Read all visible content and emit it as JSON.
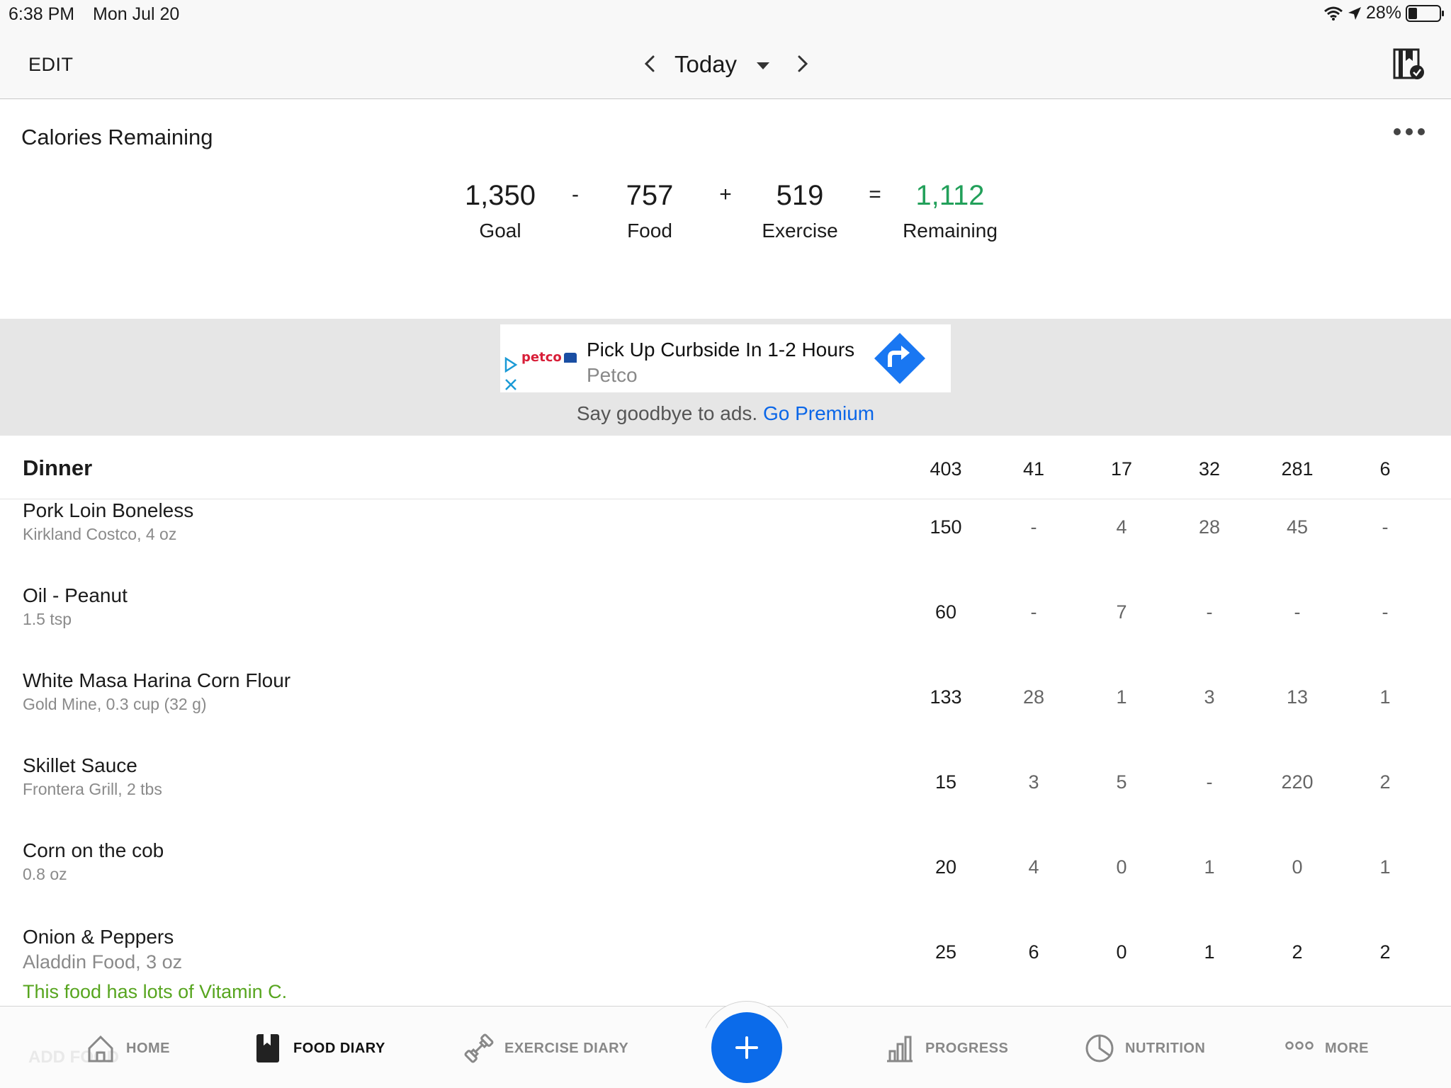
{
  "status": {
    "time": "6:38 PM",
    "date": "Mon Jul 20",
    "battery": "28%",
    "battery_level": 0.28
  },
  "nav": {
    "edit_label": "EDIT",
    "date_label": "Today"
  },
  "calories": {
    "title": "Calories Remaining",
    "goal": "1,350",
    "goal_label": "Goal",
    "op1": "-",
    "food": "757",
    "food_label": "Food",
    "op2": "+",
    "exercise": "519",
    "exercise_label": "Exercise",
    "op3": "=",
    "remaining": "1,112",
    "remaining_label": "Remaining",
    "remaining_color": "#22a05a"
  },
  "ad": {
    "brand": "petco",
    "headline": "Pick Up Curbside In 1-2 Hours",
    "sponsor": "Petco",
    "premium_text": "Say goodbye to ads.",
    "premium_link": "Go Premium"
  },
  "meal": {
    "name": "Dinner",
    "totals": [
      "403",
      "41",
      "17",
      "32",
      "281",
      "6"
    ],
    "items": [
      {
        "name": "Pork Loin Boneless",
        "desc": "Kirkland Costco, 4 oz",
        "values": [
          "150",
          "-",
          "4",
          "28",
          "45",
          "-"
        ]
      },
      {
        "name": "Oil - Peanut",
        "desc": "1.5 tsp",
        "values": [
          "60",
          "-",
          "7",
          "-",
          "-",
          "-"
        ]
      },
      {
        "name": "White Masa Harina Corn Flour",
        "desc": "Gold Mine, 0.3 cup (32 g)",
        "values": [
          "133",
          "28",
          "1",
          "3",
          "13",
          "1"
        ]
      },
      {
        "name": "Skillet Sauce",
        "desc": "Frontera Grill, 2 tbs",
        "values": [
          "15",
          "3",
          "5",
          "-",
          "220",
          "2"
        ]
      },
      {
        "name": "Corn on the cob",
        "desc": "0.8 oz",
        "values": [
          "20",
          "4",
          "0",
          "1",
          "0",
          "1"
        ]
      },
      {
        "name": "Onion & Peppers",
        "desc": "Aladdin Food, 3 oz",
        "values": [
          "25",
          "6",
          "0",
          "1",
          "2",
          "2"
        ],
        "note": "This food has lots of Vitamin C."
      }
    ],
    "add_food_label": "ADD FOOD"
  },
  "tabs": [
    {
      "label": "HOME",
      "icon": "home-icon"
    },
    {
      "label": "FOOD DIARY",
      "icon": "food-diary-icon"
    },
    {
      "label": "EXERCISE DIARY",
      "icon": "dumbbell-icon"
    },
    {
      "label": "PROGRESS",
      "icon": "bar-chart-icon"
    },
    {
      "label": "NUTRITION",
      "icon": "pie-chart-icon"
    },
    {
      "label": "MORE",
      "icon": "more-dots-icon"
    }
  ],
  "colors": {
    "accent": "#0b6bea",
    "positive": "#22a05a",
    "note_green": "#57a51f"
  }
}
